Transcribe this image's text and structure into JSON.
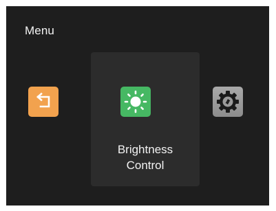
{
  "menu": {
    "title": "Menu",
    "items": [
      {
        "id": "back",
        "icon": "back-arrow-icon",
        "color": "#f2a24e"
      },
      {
        "id": "brightness",
        "icon": "sun-icon",
        "color": "#46b863",
        "label_line1": "Brightness",
        "label_line2": "Control",
        "selected": true
      },
      {
        "id": "settings",
        "icon": "gear-icon",
        "color": "#9a9a9a"
      }
    ]
  },
  "colors": {
    "background": "#1e1e1e",
    "selected_card": "#2c2c2c",
    "text": "#f3f3f3"
  }
}
